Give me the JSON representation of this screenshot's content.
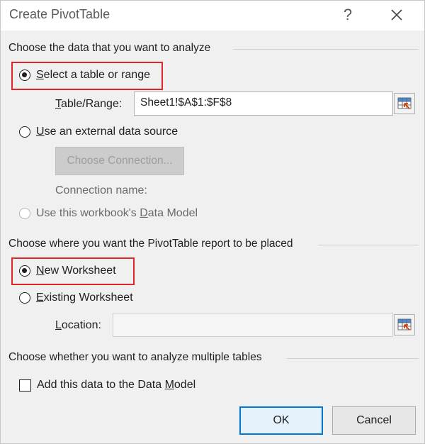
{
  "dialog": {
    "title": "Create PivotTable",
    "help_label": "?",
    "close_icon": "close-icon"
  },
  "data_section": {
    "heading": "Choose the data that you want to analyze",
    "select_table": {
      "accel": "S",
      "label_rest": "elect a table or range",
      "checked": true
    },
    "table_range": {
      "label_accel": "T",
      "label_rest": "able/Range:",
      "value": "Sheet1!$A$1:$F$8"
    },
    "external": {
      "accel": "U",
      "label_rest": "se an external data source",
      "checked": false
    },
    "choose_connection_label": "Choose Connection...",
    "connection_name_label": "Connection name:",
    "data_model_option": {
      "accel": "D",
      "label_pre": "Use this workbook's ",
      "label_post": "ata Model",
      "checked": false,
      "disabled": true
    }
  },
  "placement_section": {
    "heading": "Choose where you want the PivotTable report to be placed",
    "new_worksheet": {
      "accel": "N",
      "label_rest": "ew Worksheet",
      "checked": true
    },
    "existing_worksheet": {
      "accel": "E",
      "label_rest": "xisting Worksheet",
      "checked": false
    },
    "location": {
      "label_accel": "L",
      "label_rest": "ocation:",
      "value": ""
    }
  },
  "multiple_section": {
    "heading": "Choose whether you want to analyze multiple tables",
    "add_to_model": {
      "accel": "M",
      "label_pre": "Add this data to the Data ",
      "label_post": "odel",
      "checked": false
    }
  },
  "buttons": {
    "ok": "OK",
    "cancel": "Cancel"
  },
  "colors": {
    "highlight": "#e0252b",
    "primary_border": "#0078d7",
    "range_icon_accent": "#d83b01"
  }
}
